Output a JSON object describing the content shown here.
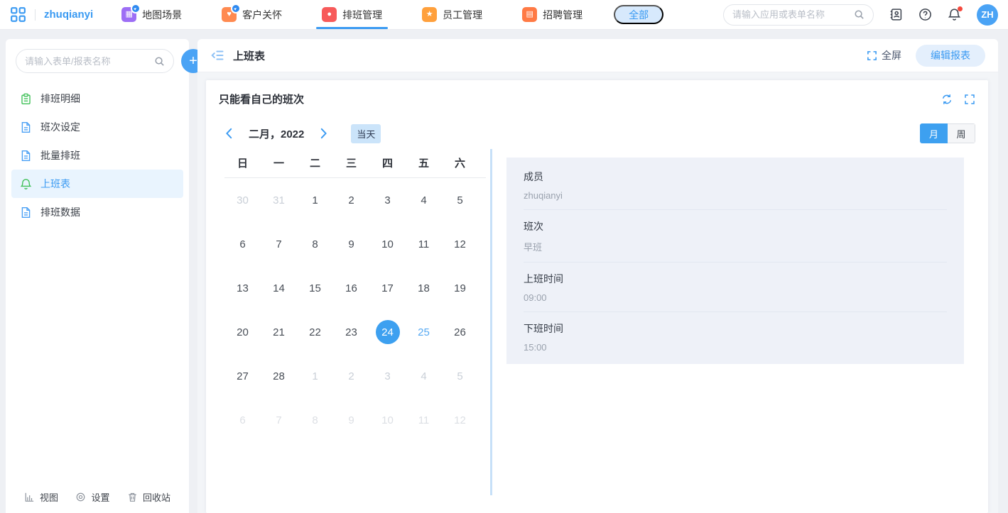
{
  "topbar": {
    "workspace": "zhuqianyi",
    "tabs": [
      {
        "name": "map-scene",
        "label": "地图场景",
        "icon": "map-app-icon",
        "color": "#9d6ef5",
        "glyph": "▦",
        "badge": true,
        "active": false
      },
      {
        "name": "customer",
        "label": "客户关怀",
        "icon": "care-app-icon",
        "color": "#ff8a50",
        "glyph": "♥",
        "badge": true,
        "active": false
      },
      {
        "name": "scheduling",
        "label": "排班管理",
        "icon": "schedule-app-icon",
        "color": "#f75a5a",
        "glyph": "●",
        "badge": false,
        "active": true
      },
      {
        "name": "staff",
        "label": "员工管理",
        "icon": "staff-app-icon",
        "color": "#ffa03c",
        "glyph": "★",
        "badge": false,
        "active": false
      },
      {
        "name": "recruiting",
        "label": "招聘管理",
        "icon": "recruit-app-icon",
        "color": "#ff7a45",
        "glyph": "▤",
        "badge": false,
        "active": false
      }
    ],
    "badge_glyph": "▸",
    "all_button": "全部",
    "search_placeholder": "请输入应用或表单名称",
    "right_icons": [
      "contacts-icon",
      "help-icon",
      "notifications-icon"
    ],
    "avatar": "ZH"
  },
  "sidebar": {
    "search_placeholder": "请输入表单/报表名称",
    "items": [
      {
        "name": "schedule-detail",
        "label": "排班明细",
        "icon": "clipboard-icon",
        "icon_color": "#3ec057",
        "active": false
      },
      {
        "name": "shift-setting",
        "label": "班次设定",
        "icon": "document-icon",
        "icon_color": "#4aa0f5",
        "active": false
      },
      {
        "name": "batch-schedule",
        "label": "批量排班",
        "icon": "document-icon",
        "icon_color": "#4aa0f5",
        "active": false
      },
      {
        "name": "work-timetable",
        "label": "上班表",
        "icon": "bell-icon",
        "icon_color": "#3ec057",
        "active": true
      },
      {
        "name": "schedule-data",
        "label": "排班数据",
        "icon": "document-icon",
        "icon_color": "#4aa0f5",
        "active": false
      }
    ],
    "footer": [
      {
        "name": "views",
        "label": "视图",
        "icon": "chart-icon"
      },
      {
        "name": "settings",
        "label": "设置",
        "icon": "gear-icon"
      },
      {
        "name": "recycle",
        "label": "回收站",
        "icon": "trash-icon"
      }
    ]
  },
  "main": {
    "title": "上班表",
    "fullscreen_label": "全屏",
    "edit_button": "编辑报表"
  },
  "report": {
    "title": "只能看自己的班次",
    "month_label": "二月，2022",
    "today_label": "当天",
    "view_toggle": {
      "month": "月",
      "week": "周",
      "selected": "月"
    }
  },
  "calendar": {
    "weekdays": [
      "日",
      "一",
      "二",
      "三",
      "四",
      "五",
      "六"
    ],
    "selected_date": "24",
    "today_date": "25",
    "weeks": [
      [
        {
          "d": "30",
          "s": "dim"
        },
        {
          "d": "31",
          "s": "dim"
        },
        {
          "d": "1"
        },
        {
          "d": "2"
        },
        {
          "d": "3"
        },
        {
          "d": "4"
        },
        {
          "d": "5"
        }
      ],
      [
        {
          "d": "6"
        },
        {
          "d": "7"
        },
        {
          "d": "8"
        },
        {
          "d": "9"
        },
        {
          "d": "10"
        },
        {
          "d": "11"
        },
        {
          "d": "12"
        }
      ],
      [
        {
          "d": "13"
        },
        {
          "d": "14"
        },
        {
          "d": "15"
        },
        {
          "d": "16"
        },
        {
          "d": "17"
        },
        {
          "d": "18"
        },
        {
          "d": "19"
        }
      ],
      [
        {
          "d": "20"
        },
        {
          "d": "21"
        },
        {
          "d": "22"
        },
        {
          "d": "23"
        },
        {
          "d": "24",
          "s": "selected"
        },
        {
          "d": "25",
          "s": "today"
        },
        {
          "d": "26"
        }
      ],
      [
        {
          "d": "27"
        },
        {
          "d": "28"
        },
        {
          "d": "1",
          "s": "dim"
        },
        {
          "d": "2",
          "s": "dim"
        },
        {
          "d": "3",
          "s": "dim"
        },
        {
          "d": "4",
          "s": "dim"
        },
        {
          "d": "5",
          "s": "dim"
        }
      ],
      [
        {
          "d": "6",
          "s": "faint"
        },
        {
          "d": "7",
          "s": "faint"
        },
        {
          "d": "8",
          "s": "faint"
        },
        {
          "d": "9",
          "s": "faint"
        },
        {
          "d": "10",
          "s": "faint"
        },
        {
          "d": "11",
          "s": "faint"
        },
        {
          "d": "12",
          "s": "faint"
        }
      ]
    ]
  },
  "detail": {
    "fields": [
      {
        "label": "成员",
        "value": "zhuqianyi"
      },
      {
        "label": "班次",
        "value": "早班"
      },
      {
        "label": "上班时间",
        "value": "09:00"
      },
      {
        "label": "下班时间",
        "value": "15:00"
      }
    ]
  },
  "colors": {
    "accent": "#3a9af2",
    "selected_day": "#3da0f0",
    "today_badge_bg": "#cbe4fa",
    "panel_bg": "#eef1f8",
    "page_bg": "#eef0f4"
  }
}
